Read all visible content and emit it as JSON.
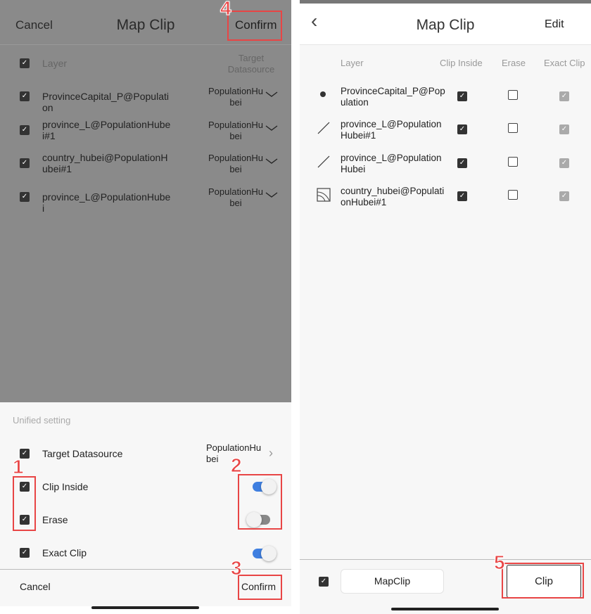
{
  "left": {
    "header": {
      "cancel": "Cancel",
      "title": "Map Clip",
      "confirm": "Confirm"
    },
    "columns": {
      "layer": "Layer",
      "target": "Target Datasource"
    },
    "rows": [
      {
        "layer": "ProvinceCapital_P@Population",
        "target": "PopulationHubei",
        "checked": true
      },
      {
        "layer": "province_L@PopulationHubei#1",
        "target": "PopulationHubei",
        "checked": true
      },
      {
        "layer": "country_hubei@PopulationHubei#1",
        "target": "PopulationHubei",
        "checked": true
      },
      {
        "layer": "province_L@PopulationHubei",
        "target": "PopulationHubei",
        "checked": true
      }
    ],
    "sheet": {
      "title": "Unified setting",
      "target_label": "Target Datasource",
      "target_value": "PopulationHubei",
      "clip_inside": "Clip Inside",
      "clip_inside_on": true,
      "erase": "Erase",
      "erase_on": false,
      "exact_clip": "Exact Clip",
      "exact_clip_on": true,
      "cancel": "Cancel",
      "confirm": "Confirm"
    }
  },
  "right": {
    "header": {
      "title": "Map Clip",
      "edit": "Edit"
    },
    "columns": {
      "layer": "Layer",
      "clip_inside": "Clip Inside",
      "erase": "Erase",
      "exact_clip": "Exact Clip"
    },
    "rows": [
      {
        "icon": "point-icon",
        "layer": "ProvinceCapital_P@Population",
        "clip_inside": true,
        "erase": false,
        "exact_clip": true
      },
      {
        "icon": "line-icon",
        "layer": "province_L@PopulationHubei#1",
        "clip_inside": true,
        "erase": false,
        "exact_clip": true
      },
      {
        "icon": "line-icon",
        "layer": "province_L@PopulationHubei",
        "clip_inside": true,
        "erase": false,
        "exact_clip": true
      },
      {
        "icon": "region-icon",
        "layer": "country_hubei@PopulationHubei#1",
        "clip_inside": true,
        "erase": false,
        "exact_clip": true
      }
    ],
    "footer": {
      "mapclip": "MapClip",
      "clip": "Clip"
    }
  },
  "annotations": [
    "1",
    "2",
    "3",
    "4",
    "5"
  ],
  "colors": {
    "accent": "#3f7fe0",
    "annotation": "#e84545"
  }
}
